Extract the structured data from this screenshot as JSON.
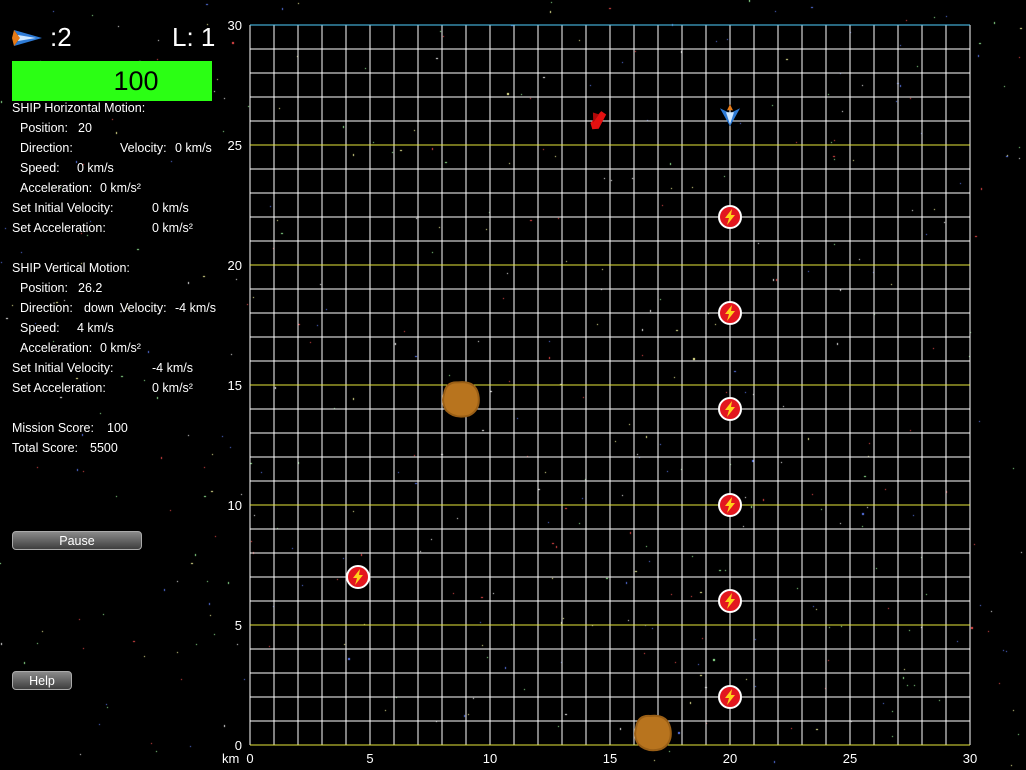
{
  "hud": {
    "lives_label": ":2",
    "level_label": "L: 1",
    "fuel": {
      "value": "100",
      "color": "#2bff14"
    }
  },
  "horizontal": {
    "title": "SHIP Horizontal Motion:",
    "position_label": "Position:",
    "position_value": "20",
    "direction_label": "Direction:",
    "direction_value": "",
    "velocity_label": "Velocity:",
    "velocity_value": "0 km/s",
    "speed_label": "Speed:",
    "speed_value": "0 km/s",
    "acceleration_label": "Acceleration:",
    "acceleration_value": "0 km/s²",
    "set_velocity_label": "Set Initial Velocity:",
    "set_velocity_value": "0 km/s",
    "set_accel_label": "Set Acceleration:",
    "set_accel_value": "0 km/s²"
  },
  "vertical": {
    "title": "SHIP Vertical Motion:",
    "position_label": "Position:",
    "position_value": "26.2",
    "direction_label": "Direction:",
    "direction_value": "down",
    "velocity_label": "Velocity:",
    "velocity_value": "-4 km/s",
    "speed_label": "Speed:",
    "speed_value": "4 km/s",
    "acceleration_label": "Acceleration:",
    "acceleration_value": "0 km/s²",
    "set_velocity_label": "Set Initial Velocity:",
    "set_velocity_value": "-4 km/s",
    "set_accel_label": "Set Acceleration:",
    "set_accel_value": "0 km/s²"
  },
  "scores": {
    "mission_label": "Mission Score:",
    "mission_value": "100",
    "total_label": "Total Score:",
    "total_value": "5500"
  },
  "buttons": {
    "pause": "Pause",
    "help": "Help"
  },
  "grid": {
    "unit_label": "km",
    "x_range": [
      0,
      30
    ],
    "y_range": [
      0,
      30
    ],
    "x_ticks": [
      "0",
      "5",
      "10",
      "15",
      "20",
      "25",
      "30"
    ],
    "y_ticks": [
      "0",
      "5",
      "10",
      "15",
      "20",
      "25",
      "30"
    ],
    "line_color": "#ffffff",
    "major_line_color": "#e6e63a",
    "top_line_color": "#4fd0ff"
  },
  "objects": {
    "ship": {
      "x": 20,
      "y": 26.2,
      "icon": "player-ship-icon"
    },
    "enemy": {
      "x": 14.5,
      "y": 26.0,
      "icon": "red-enemy-ship-icon"
    },
    "fuel_cells": [
      {
        "x": 20,
        "y": 22
      },
      {
        "x": 20,
        "y": 18
      },
      {
        "x": 20,
        "y": 14
      },
      {
        "x": 20,
        "y": 10
      },
      {
        "x": 20,
        "y": 6
      },
      {
        "x": 20,
        "y": 2
      },
      {
        "x": 4.5,
        "y": 7
      }
    ],
    "asteroids": [
      {
        "x": 8.8,
        "y": 14.4
      },
      {
        "x": 16.8,
        "y": 0.5
      }
    ]
  }
}
